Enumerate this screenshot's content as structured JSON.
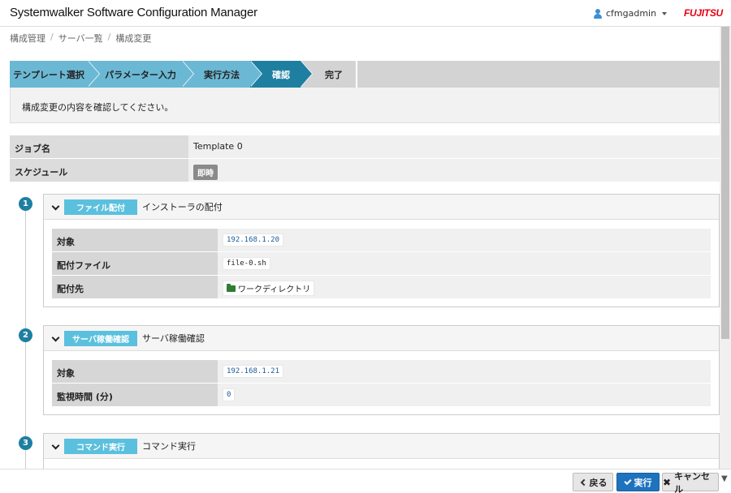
{
  "app": {
    "title": "Systemwalker Software Configuration Manager",
    "user": "cfmgadmin",
    "logo": "FUJITSU"
  },
  "breadcrumb": [
    "構成管理",
    "サーバ一覧",
    "構成変更"
  ],
  "wizard": {
    "steps": [
      {
        "label": "テンプレート選択",
        "state": "done"
      },
      {
        "label": "パラメーター入力",
        "state": "done"
      },
      {
        "label": "実行方法",
        "state": "done"
      },
      {
        "label": "確認",
        "state": "active"
      },
      {
        "label": "完了",
        "state": "todo"
      }
    ]
  },
  "message": "構成変更の内容を確認してください。",
  "job": {
    "name_label": "ジョブ名",
    "name_value": "Template 0",
    "schedule_label": "スケジュール",
    "schedule_value": "即時"
  },
  "tasks": [
    {
      "num": "1",
      "type": "ファイル配付",
      "title": "インストーラの配付",
      "rows": [
        {
          "key": "対象",
          "value": "192.168.1.20"
        },
        {
          "key": "配付ファイル",
          "value": "file-0.sh"
        },
        {
          "key": "配付先",
          "value": "ワークディレクトリ"
        }
      ]
    },
    {
      "num": "2",
      "type": "サーバ稼働確認",
      "title": "サーバ稼働確認",
      "rows": [
        {
          "key": "対象",
          "value": "192.168.1.21"
        },
        {
          "key": "監視時間 (分)",
          "value": "0"
        }
      ]
    },
    {
      "num": "3",
      "type": "コマンド実行",
      "title": "コマンド実行"
    }
  ],
  "footer": {
    "back": "戻る",
    "run": "実行",
    "cancel": "キャンセル"
  },
  "colors": {
    "active_step": "#1e7fa1",
    "done_step": "#6bb8d4",
    "badge": "#5bc0de",
    "primary": "#1e73be"
  }
}
